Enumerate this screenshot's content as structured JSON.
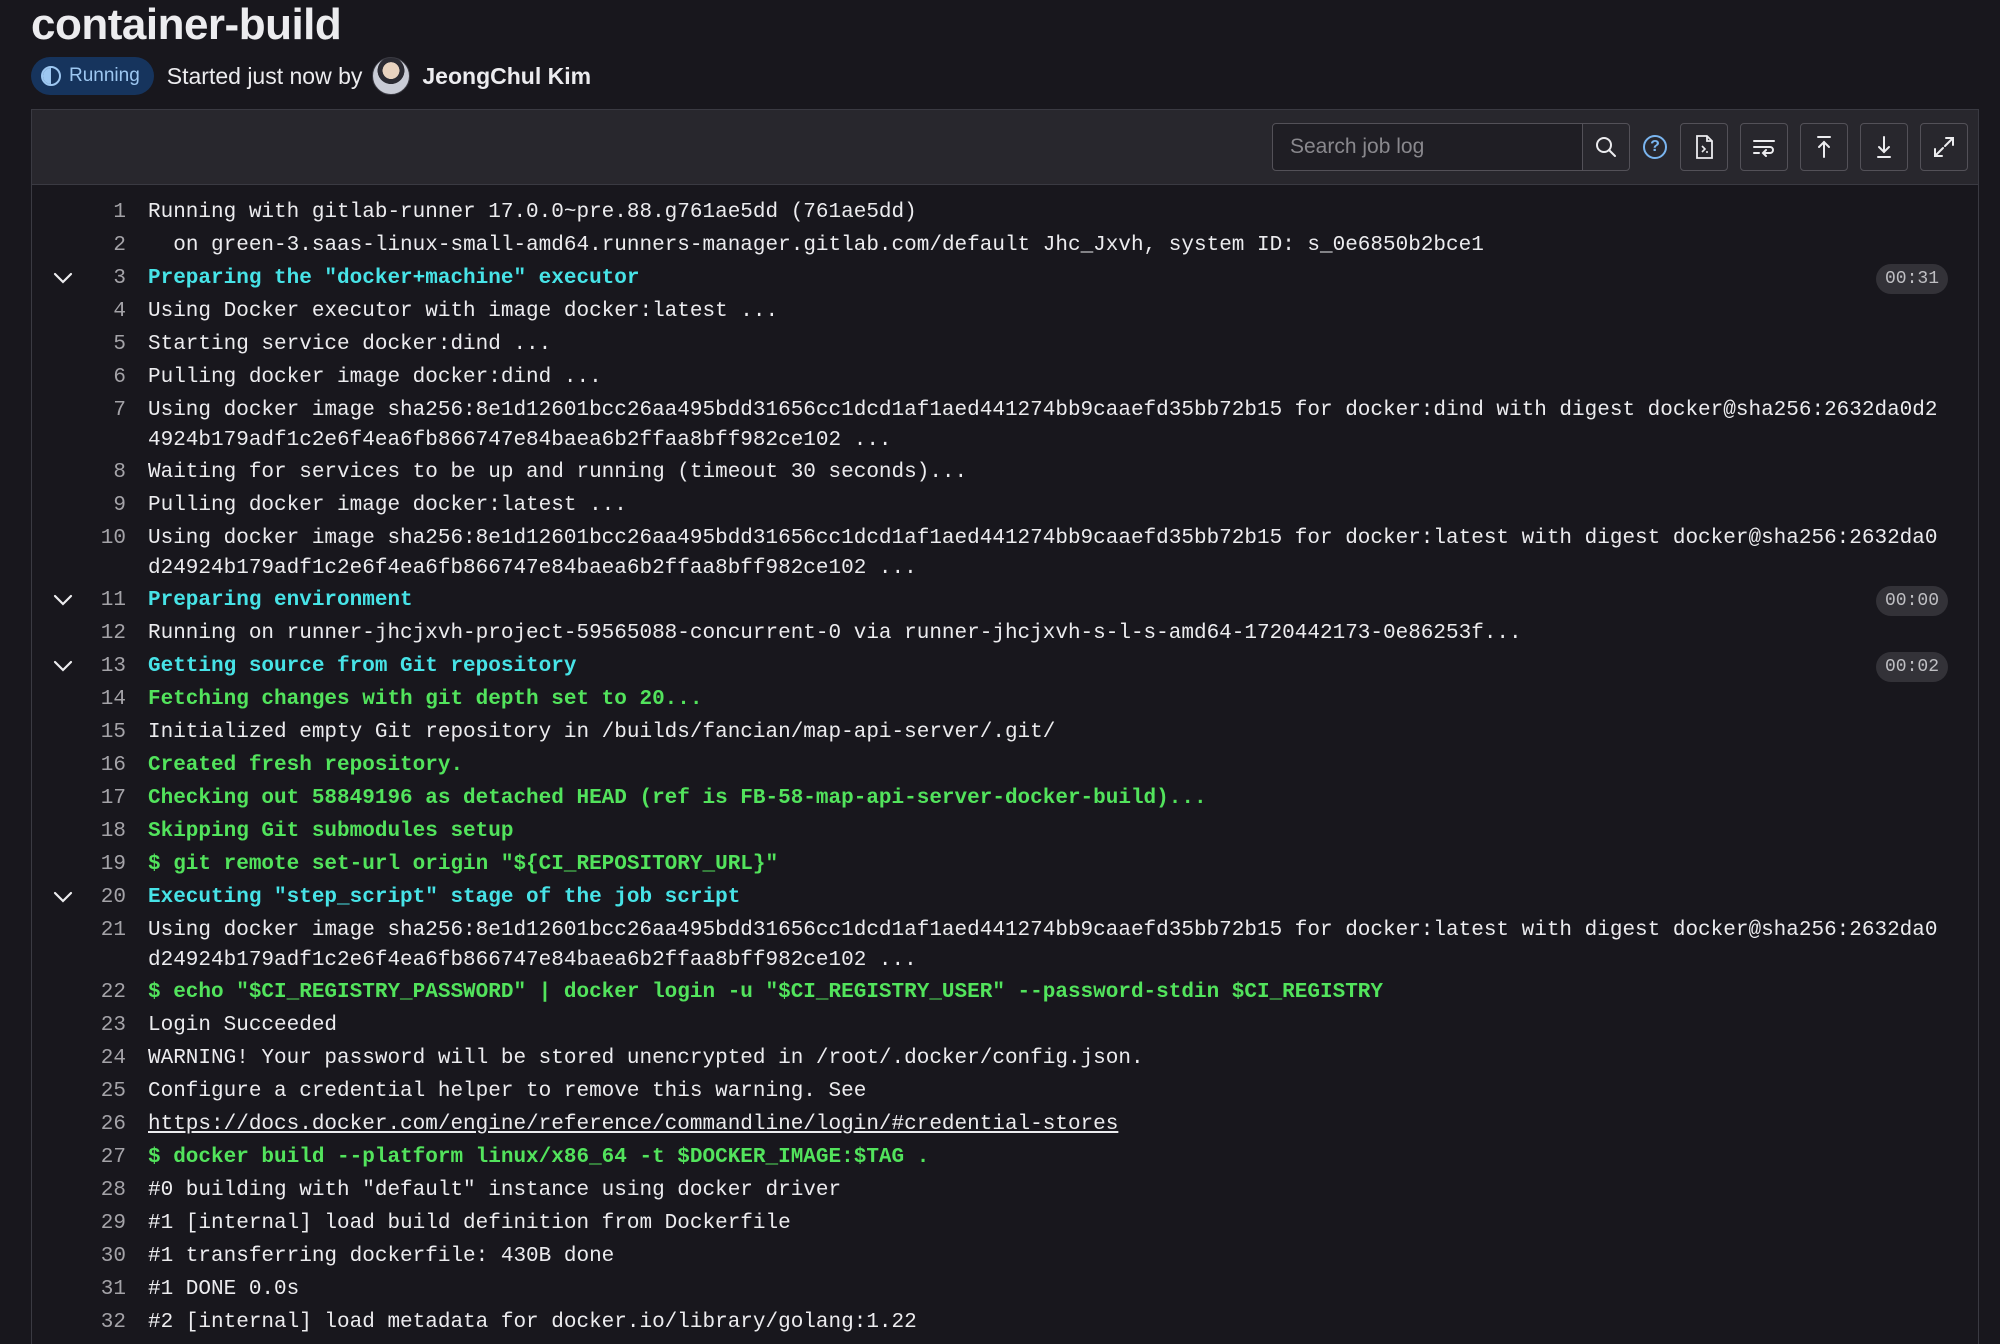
{
  "header": {
    "title": "container-build",
    "status_label": "Running",
    "started_text": "Started just now by",
    "author": "JeongChul Kim"
  },
  "toolbar": {
    "search_placeholder": "Search job log",
    "icons": [
      "search-icon",
      "help-icon",
      "raw-log-icon",
      "line-wrap-icon",
      "scroll-top-icon",
      "scroll-bottom-icon",
      "fullscreen-icon"
    ]
  },
  "log": {
    "lines": [
      {
        "n": "1",
        "text": "Running with gitlab-runner 17.0.0~pre.88.g761ae5dd (761ae5dd)"
      },
      {
        "n": "2",
        "text": "  on green-3.saas-linux-small-amd64.runners-manager.gitlab.com/default Jhc_Jxvh, system ID: s_0e6850b2bce1"
      },
      {
        "n": "3",
        "text": "Preparing the \"docker+machine\" executor",
        "duration": "00:31"
      },
      {
        "n": "4",
        "text": "Using Docker executor with image docker:latest ..."
      },
      {
        "n": "5",
        "text": "Starting service docker:dind ..."
      },
      {
        "n": "6",
        "text": "Pulling docker image docker:dind ..."
      },
      {
        "n": "7",
        "text": "Using docker image sha256:8e1d12601bcc26aa495bdd31656cc1dcd1af1aed441274bb9caaefd35bb72b15 for docker:dind with digest docker@sha256:2632da0d24924b179adf1c2e6f4ea6fb866747e84baea6b2ffaa8bff982ce102 ..."
      },
      {
        "n": "8",
        "text": "Waiting for services to be up and running (timeout 30 seconds)..."
      },
      {
        "n": "9",
        "text": "Pulling docker image docker:latest ..."
      },
      {
        "n": "10",
        "text": "Using docker image sha256:8e1d12601bcc26aa495bdd31656cc1dcd1af1aed441274bb9caaefd35bb72b15 for docker:latest with digest docker@sha256:2632da0d24924b179adf1c2e6f4ea6fb866747e84baea6b2ffaa8bff982ce102 ..."
      },
      {
        "n": "11",
        "text": "Preparing environment",
        "duration": "00:00"
      },
      {
        "n": "12",
        "text": "Running on runner-jhcjxvh-project-59565088-concurrent-0 via runner-jhcjxvh-s-l-s-amd64-1720442173-0e86253f..."
      },
      {
        "n": "13",
        "text": "Getting source from Git repository",
        "duration": "00:02"
      },
      {
        "n": "14",
        "text": "Fetching changes with git depth set to 20..."
      },
      {
        "n": "15",
        "text": "Initialized empty Git repository in /builds/fancian/map-api-server/.git/"
      },
      {
        "n": "16",
        "text": "Created fresh repository."
      },
      {
        "n": "17",
        "text": "Checking out 58849196 as detached HEAD (ref is FB-58-map-api-server-docker-build)..."
      },
      {
        "n": "18",
        "text": "Skipping Git submodules setup"
      },
      {
        "n": "19",
        "text": "$ git remote set-url origin \"${CI_REPOSITORY_URL}\""
      },
      {
        "n": "20",
        "text": "Executing \"step_script\" stage of the job script"
      },
      {
        "n": "21",
        "text": "Using docker image sha256:8e1d12601bcc26aa495bdd31656cc1dcd1af1aed441274bb9caaefd35bb72b15 for docker:latest with digest docker@sha256:2632da0d24924b179adf1c2e6f4ea6fb866747e84baea6b2ffaa8bff982ce102 ..."
      },
      {
        "n": "22",
        "text": "$ echo \"$CI_REGISTRY_PASSWORD\" | docker login -u \"$CI_REGISTRY_USER\" --password-stdin $CI_REGISTRY"
      },
      {
        "n": "23",
        "text": "Login Succeeded"
      },
      {
        "n": "24",
        "text": "WARNING! Your password will be stored unencrypted in /root/.docker/config.json."
      },
      {
        "n": "25",
        "text": "Configure a credential helper to remove this warning. See"
      },
      {
        "n": "26",
        "text": "https://docs.docker.com/engine/reference/commandline/login/#credential-stores"
      },
      {
        "n": "27",
        "text": "$ docker build --platform linux/x86_64 -t $DOCKER_IMAGE:$TAG ."
      },
      {
        "n": "28",
        "text": "#0 building with \"default\" instance using docker driver"
      },
      {
        "n": "29",
        "text": "#1 [internal] load build definition from Dockerfile"
      },
      {
        "n": "30",
        "text": "#1 transferring dockerfile: 430B done"
      },
      {
        "n": "31",
        "text": "#1 DONE 0.0s"
      },
      {
        "n": "32",
        "text": "#2 [internal] load metadata for docker.io/library/golang:1.22"
      }
    ]
  }
}
